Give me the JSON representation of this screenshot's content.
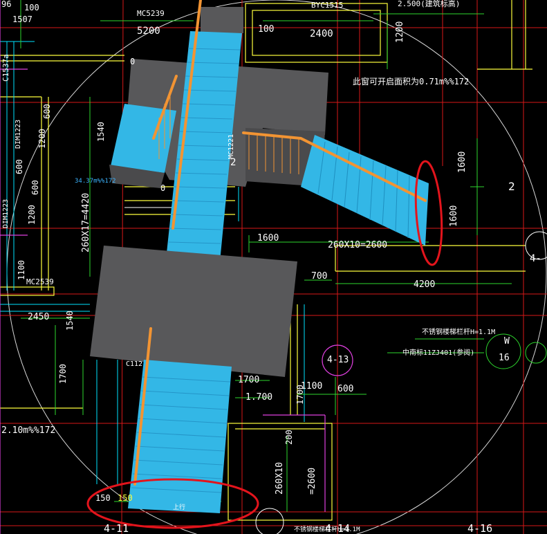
{
  "labels": {
    "top_left_96": "96",
    "top_left_100": "100",
    "top_left_1507": "1507",
    "mc5239": "MC5239",
    "dim_5200": "5200",
    "dim_100": "100",
    "dim_2400": "2400",
    "dim_1200_top": "1200",
    "byc1515": "BYC1515",
    "elev_2500": "2.500(建筑标高)",
    "c1537a": "C1537a",
    "slope_071": "此窗可开启面积为0.71m%%172",
    "dim_600_a": "600",
    "dim_1200_a": "1200",
    "dim_600_b": "600",
    "dim_1200_b": "1200",
    "dim_600_c": "600",
    "dim_1540_a": "1540",
    "dim1223_a": "DIM1223",
    "dim1223_b": "DIM1223",
    "mc1221": "MC1221",
    "elev_3437": "34.37m%%172",
    "dim_260x17": "260X17=4420",
    "dim_1100": "1100",
    "mc2539": "MC2539",
    "dim_1600_mid": "1600",
    "dim_260x10": "260X10=2600",
    "dim_1600_r1": "1600",
    "dim_1600_r2": "1600",
    "dim_700": "700",
    "dim_4200": "4200",
    "dim_2450": "2450",
    "dim_1540_b": "1540",
    "rail_note": "不锈钢楼梯栏杆H=1.1M",
    "stair_note": "中南标11ZJ401(参阅)",
    "dim_1700_left": "1700",
    "c112": "C112",
    "dim_1700_mid": "1700",
    "elev_1700": "1.700",
    "dim_1100_b": "1100",
    "dim_600_d": "600",
    "dim_1700_v": "1700",
    "slope_210": "2.10m%%172",
    "dim_260x10_v": "260X10",
    "dim_2600_v": "=2600",
    "dim_200": "200",
    "dim_150_a": "150",
    "dim_150_b": "150",
    "up_label": "上行",
    "axis_4_11": "4-11",
    "axis_4_14": "4-14",
    "axis_4_16": "4-16",
    "axis_4_13": "4-13",
    "axis_4_right": "4-",
    "axis_w": "W",
    "axis_16": "16",
    "footer_note": "不锈钢楼梯栏杆H=1.1M",
    "right_num_2": "2",
    "right_num_2b": "2",
    "label_0": "0",
    "label_0b": "0"
  },
  "colors": {
    "background": "#000000",
    "stair_blue": "#33b7e6",
    "landing_gray": "#58585a",
    "rail_orange": "#f29433",
    "annotation_red": "#e3141c",
    "cad_red": "#e01818",
    "cad_yellow": "#ffff3c",
    "cad_cyan": "#00e5ff",
    "cad_magenta": "#e040e0",
    "cad_green": "#2ed82e",
    "cad_white": "#ffffff"
  },
  "icons": {
    "annotation_top": "red-ellipse-highlight",
    "annotation_bottom": "red-ellipse-highlight"
  }
}
